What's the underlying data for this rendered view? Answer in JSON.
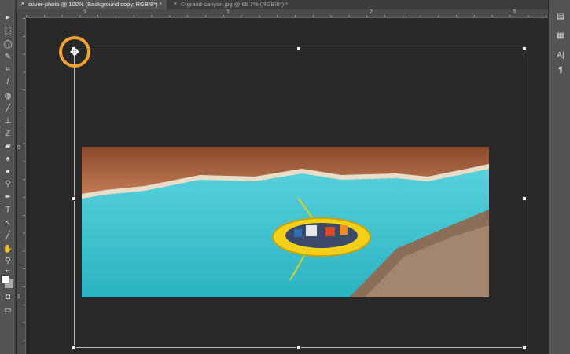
{
  "tabs": [
    {
      "label": "cover-photo @ 100% (Background copy, RGB/8*) *",
      "active": true
    },
    {
      "label": "© grand-canyon.jpg @ 66.7% (RGB/8*) *",
      "active": false
    }
  ],
  "ruler": {
    "top_labels": [
      "0",
      "1",
      "2",
      "3"
    ],
    "left_labels": [
      "0",
      "1"
    ]
  },
  "tools": [
    "move",
    "marquee",
    "lasso",
    "quick-selection",
    "crop",
    "eyedropper",
    "healing-brush",
    "brush",
    "clone-stamp",
    "history-brush",
    "eraser",
    "paint-bucket",
    "blur",
    "dodge",
    "pen",
    "type",
    "path-selection",
    "line",
    "hand",
    "zoom",
    "swap-colors",
    "foreground-background",
    "quick-mask",
    "screen-mode"
  ],
  "type_tool_label": "T",
  "panel_icons": [
    "history",
    "properties",
    "character",
    "paragraph"
  ],
  "colors": {
    "accent": "#f2a22f",
    "foreground": "#ffffff",
    "background": "#aaaaaa"
  }
}
